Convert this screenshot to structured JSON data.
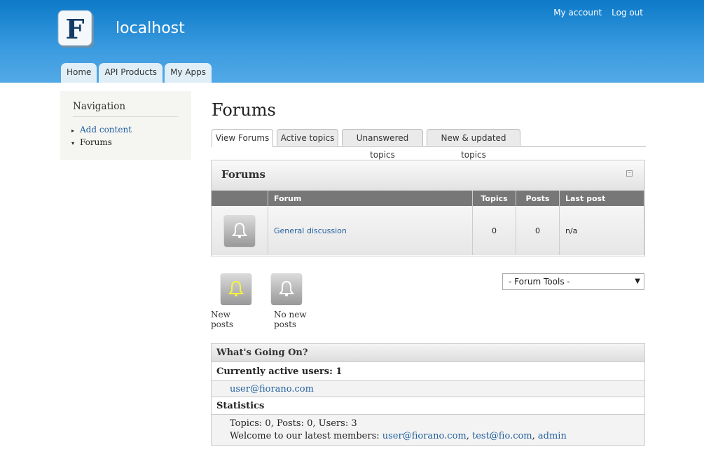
{
  "header": {
    "site_name": "localhost",
    "logo_letter": "F",
    "secondary_links": [
      "My account",
      "Log out"
    ],
    "primary_tabs": [
      "Home",
      "API Products",
      "My Apps"
    ]
  },
  "sidebar": {
    "title": "Navigation",
    "items": [
      {
        "label": "Add content",
        "arrow": "▸"
      },
      {
        "label": "Forums",
        "arrow": "▾"
      }
    ]
  },
  "main": {
    "title": "Forums",
    "tabs": [
      "View Forums",
      "Active topics",
      "Unanswered topics",
      "New & updated topics"
    ],
    "panel_title": "Forums",
    "table": {
      "headers": [
        "",
        "Forum",
        "Topics",
        "Posts",
        "Last post"
      ],
      "rows": [
        {
          "forum": "General discussion",
          "topics": "0",
          "posts": "0",
          "last_post": "n/a"
        }
      ]
    },
    "legend": {
      "new_posts": "New posts",
      "no_new_posts": "No new posts"
    },
    "forum_tools": "- Forum Tools -"
  },
  "going_on": {
    "title": "What's Going On?",
    "active_users_heading": "Currently active users: 1",
    "active_users": [
      "user@fiorano.com"
    ],
    "statistics_heading": "Statistics",
    "stats_line": "Topics: 0, Posts: 0, Users: 3",
    "welcome_prefix": "Welcome to our latest members:",
    "latest_members": [
      "user@fiorano.com",
      "test@fio.com",
      "admin"
    ]
  },
  "colors": {
    "header": "#0c7ac8",
    "link": "#1f5f9e",
    "new_bell": "#f6f43a"
  }
}
